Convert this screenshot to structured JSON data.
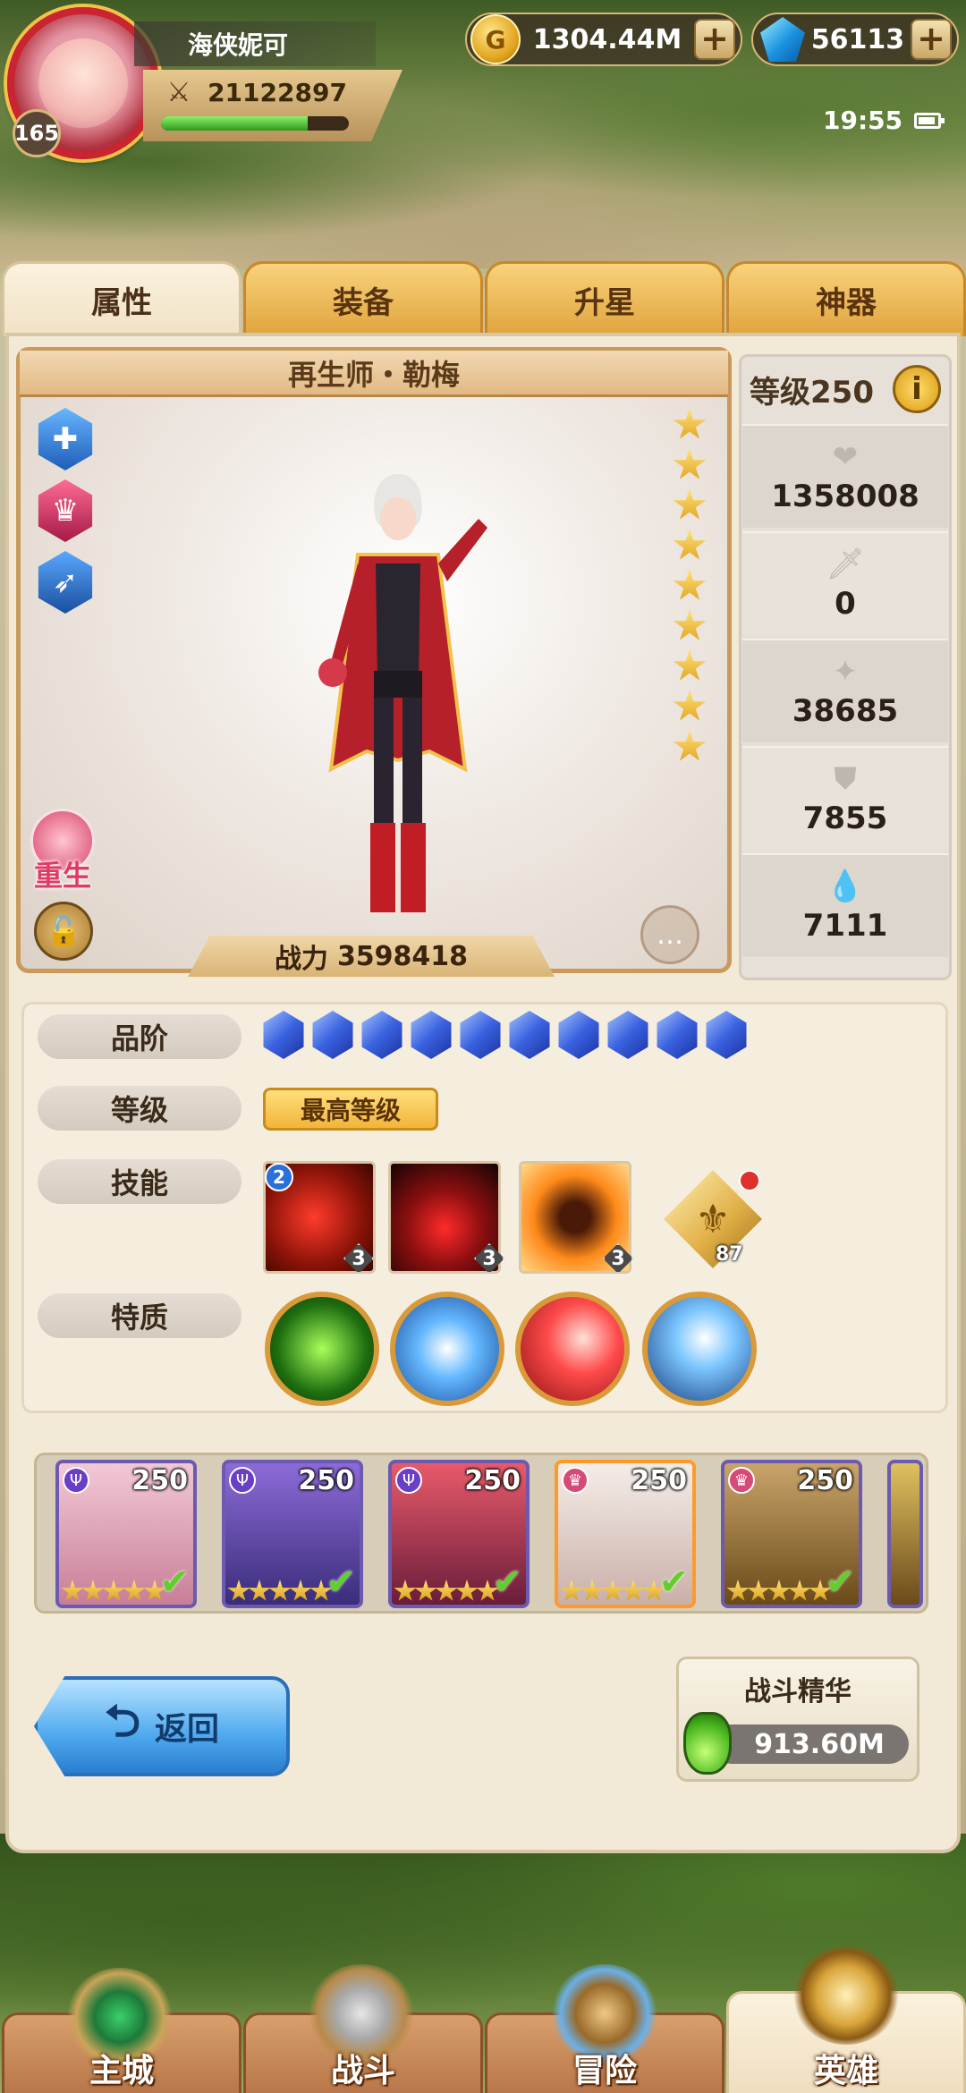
{
  "player": {
    "name": "海侠妮可",
    "level": "165",
    "power": "21122897",
    "exp_fraction": 0.78
  },
  "currency": {
    "gold": "1304.44M",
    "gems": "56113"
  },
  "status_bar": {
    "time": "19:55"
  },
  "tabs": [
    {
      "label": "属性",
      "active": true
    },
    {
      "label": "装备",
      "active": false
    },
    {
      "label": "升星",
      "active": false
    },
    {
      "label": "神器",
      "active": false
    }
  ],
  "hero": {
    "name": "再生师・勒梅",
    "power_label": "战力",
    "power_value": "3598418",
    "stars": 9,
    "rebirth_label": "重生"
  },
  "stats": {
    "level_label": "等级250",
    "info_icon": "i",
    "rows": [
      {
        "icon": "heart-icon",
        "value": "1358008"
      },
      {
        "icon": "sword-icon",
        "value": "0"
      },
      {
        "icon": "burst-icon",
        "value": "38685"
      },
      {
        "icon": "shield-icon",
        "value": "7855"
      },
      {
        "icon": "drop-icon",
        "value": "7111"
      }
    ]
  },
  "attributes": {
    "quality_label": "品阶",
    "quality_gems": 10,
    "level_label": "等级",
    "level_value": "最高等级",
    "skills_label": "技能",
    "skills": [
      {
        "level": "3",
        "badge": "2"
      },
      {
        "level": "3"
      },
      {
        "level": "3"
      }
    ],
    "emblem_count": "87",
    "traits_label": "特质"
  },
  "roster": [
    {
      "level": "250",
      "stars": 5,
      "selected": false
    },
    {
      "level": "250",
      "stars": 5,
      "selected": false
    },
    {
      "level": "250",
      "stars": 5,
      "selected": false
    },
    {
      "level": "250",
      "stars": 5,
      "selected": true
    },
    {
      "level": "250",
      "stars": 5,
      "selected": false
    }
  ],
  "back_button": {
    "label": "返回"
  },
  "essence": {
    "title": "战斗精华",
    "value": "913.60M"
  },
  "nav": [
    {
      "label": "主城",
      "active": false
    },
    {
      "label": "战斗",
      "active": false
    },
    {
      "label": "冒险",
      "active": false
    },
    {
      "label": "英雄",
      "active": true
    }
  ]
}
